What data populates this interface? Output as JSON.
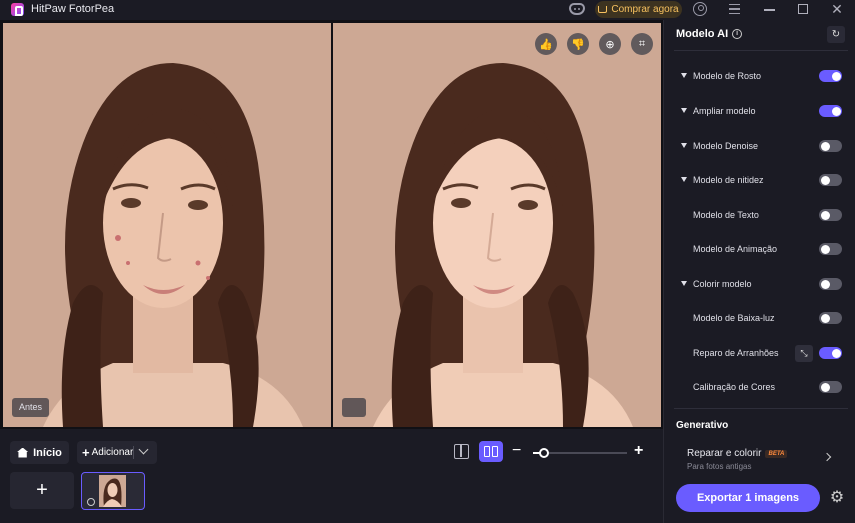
{
  "window": {
    "app_title": "HitPaw FotorPea",
    "buy_label": "Comprar agora",
    "close_glyph": "✕"
  },
  "viewer": {
    "before_label": "Antes",
    "after_label": "",
    "tools": [
      {
        "icon": "thumbs-up-icon",
        "glyph": "👍"
      },
      {
        "icon": "thumbs-down-icon",
        "glyph": "👎"
      },
      {
        "icon": "zoom-icon",
        "glyph": "⊕"
      },
      {
        "icon": "crop-icon",
        "glyph": "⌗"
      }
    ]
  },
  "bottom_bar": {
    "home_label": "Início",
    "add_label": "Adicionar",
    "add_tile_glyph": "+",
    "zoom_minus": "−",
    "zoom_plus": "+",
    "zoom_level": 0.1
  },
  "panel": {
    "title": "Modelo AI",
    "info_glyph": "i",
    "reset_glyph": "↻",
    "models": [
      {
        "label": "Modelo de Rosto",
        "expandable": true,
        "on": true
      },
      {
        "label": "Ampliar modelo",
        "expandable": true,
        "on": true
      },
      {
        "label": "Modelo Denoise",
        "expandable": true,
        "on": false
      },
      {
        "label": "Modelo de nitidez",
        "expandable": true,
        "on": false
      },
      {
        "label": "Modelo de Texto",
        "expandable": false,
        "on": false
      },
      {
        "label": "Modelo de Animação",
        "expandable": false,
        "on": false
      },
      {
        "label": "Colorir modelo",
        "expandable": true,
        "on": false
      },
      {
        "label": "Modelo de Baixa-luz",
        "expandable": false,
        "on": false
      },
      {
        "label": "Reparo de Arranhões",
        "expandable": false,
        "on": true
      },
      {
        "label": "Calibração de Cores",
        "expandable": false,
        "on": false
      }
    ],
    "wand_glyph": "⤡",
    "generative_title": "Generativo",
    "repair_title": "Reparar e colorir",
    "repair_badge": "BETA",
    "repair_subtitle": "Para fotos antigas",
    "export_label": "Exportar 1 imagens",
    "gear_glyph": "⚙"
  },
  "colors": {
    "accent": "#6a5cff",
    "background": "#1b1b24",
    "buy_text": "#f7c15f"
  }
}
